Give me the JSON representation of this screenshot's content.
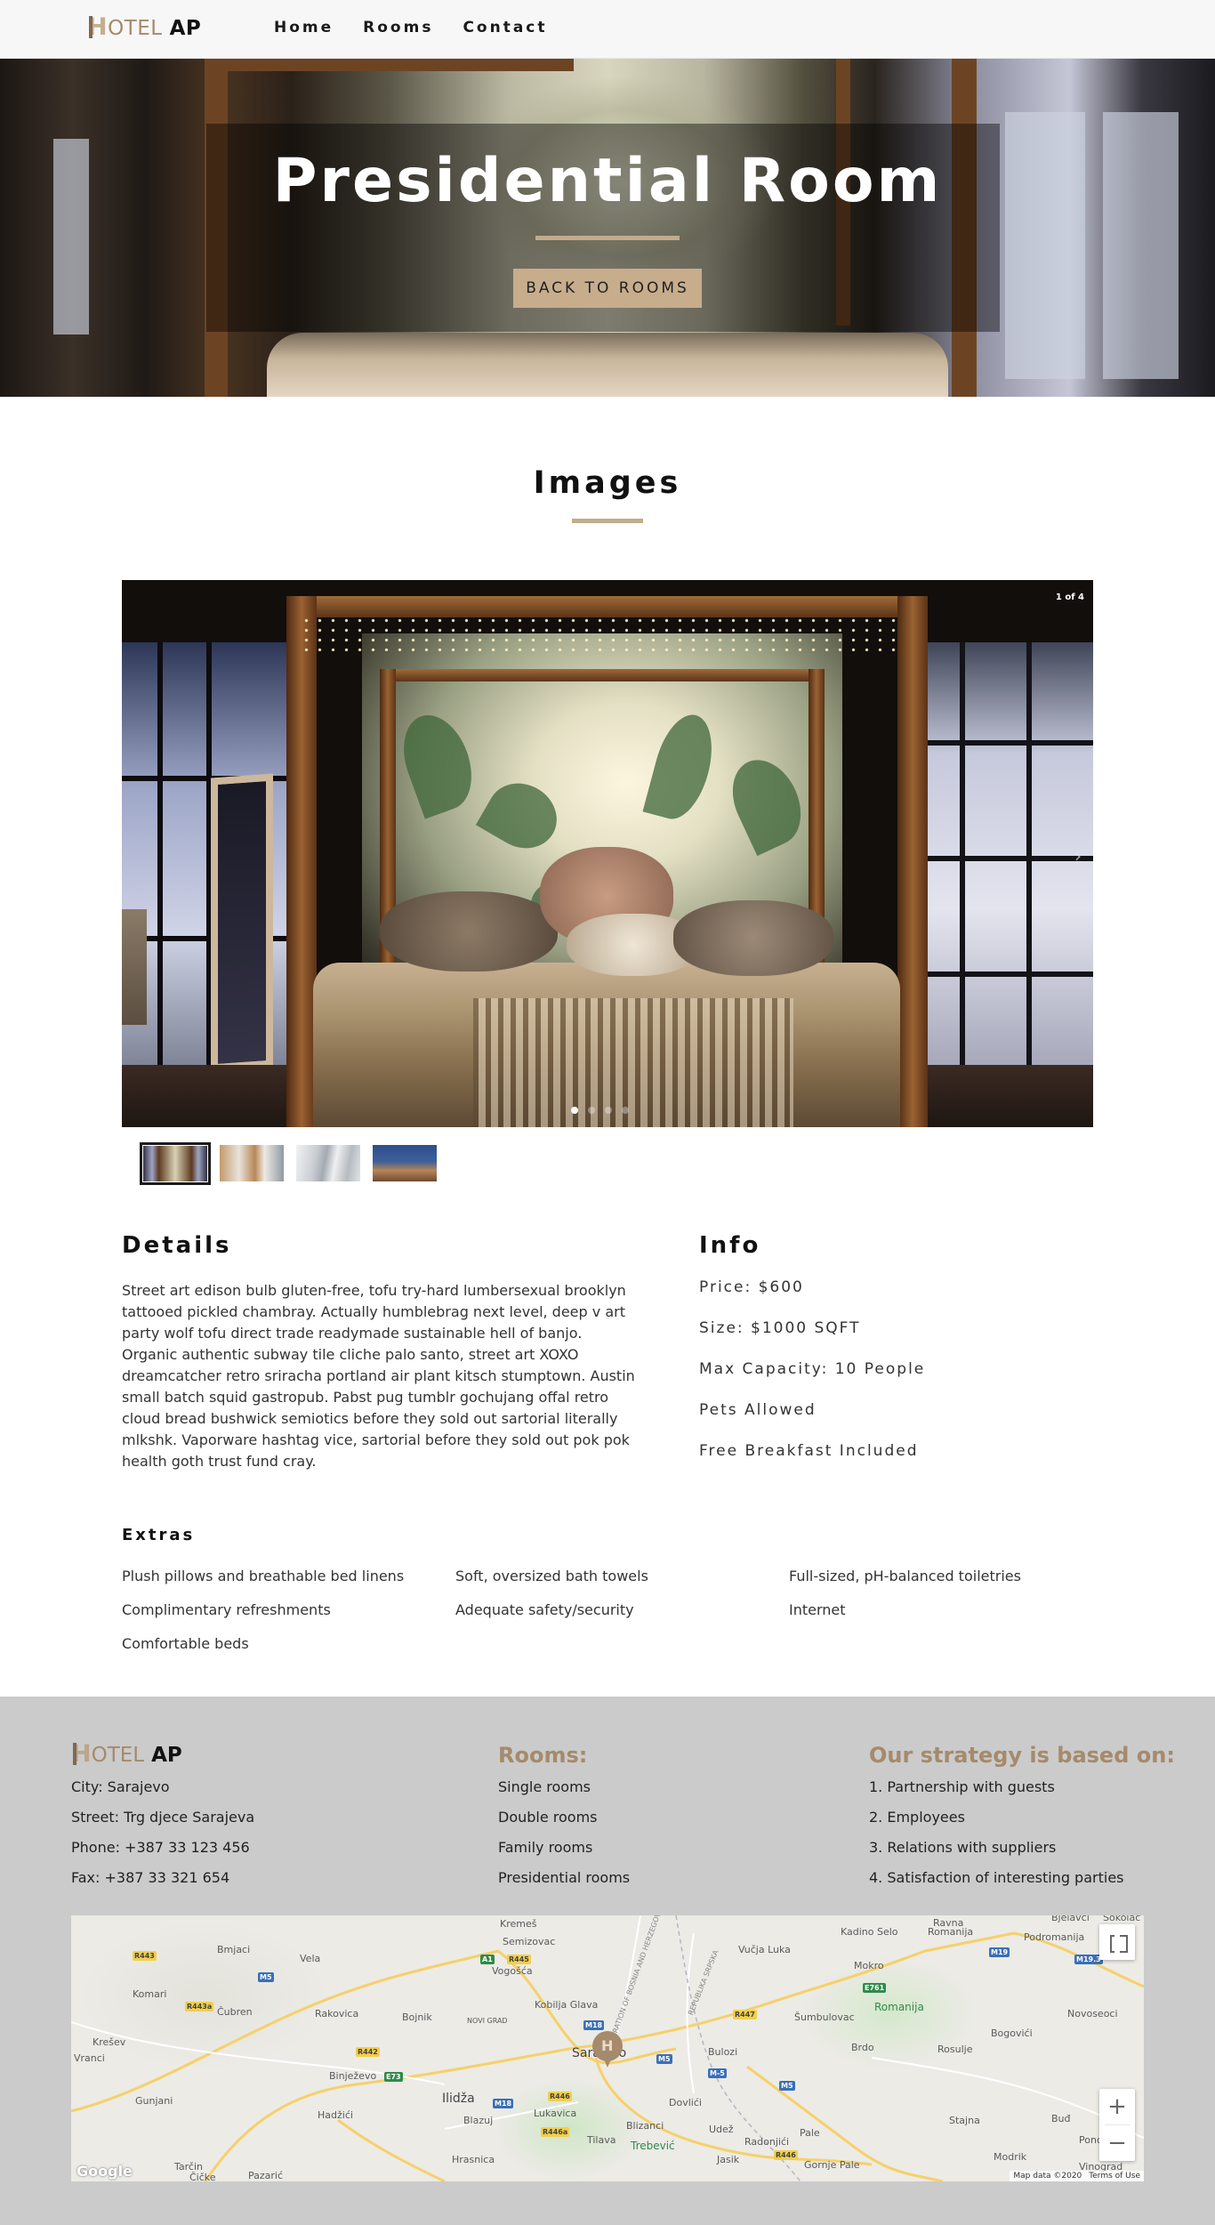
{
  "brand": {
    "logo_h": "H",
    "logo_otel": "OTEL",
    "logo_ap": "AP"
  },
  "nav": {
    "items": [
      "Home",
      "Rooms",
      "Contact"
    ]
  },
  "hero": {
    "title": "Presidential Room",
    "button": "BACK TO ROOMS"
  },
  "images_section": {
    "title": "Images"
  },
  "gallery": {
    "counter": "1 of 4",
    "next_icon": "›",
    "dots_total": 4,
    "active_index": 1
  },
  "details": {
    "heading": "Details",
    "text": "Street art edison bulb gluten-free, tofu try-hard lumbersexual brooklyn tattooed pickled chambray. Actually humblebrag next level, deep v art party wolf tofu direct trade readymade sustainable hell of banjo. Organic authentic subway tile cliche palo santo, street art XOXO dreamcatcher retro sriracha portland air plant kitsch stumptown. Austin small batch squid gastropub. Pabst pug tumblr gochujang offal retro cloud bread bushwick semiotics before they sold out sartorial literally mlkshk. Vaporware hashtag vice, sartorial before they sold out pok pok health goth trust fund cray."
  },
  "info": {
    "heading": "Info",
    "items": [
      "Price: $600",
      "Size: $1000 SQFT",
      "Max Capacity: 10 People",
      "Pets Allowed",
      "Free Breakfast Included"
    ]
  },
  "extras": {
    "heading": "Extras",
    "items": [
      "Plush pillows and breathable bed linens",
      "Soft, oversized bath towels",
      "Full-sized, pH-balanced toiletries",
      "Complimentary refreshments",
      "Adequate safety/security",
      "Internet",
      "Comfortable beds"
    ]
  },
  "footer": {
    "contact": [
      "City: Sarajevo",
      "Street: Trg djece Sarajeva",
      "Phone: +387 33 123 456",
      "Fax: +387 33 321 654"
    ],
    "rooms_title": "Rooms:",
    "rooms": [
      "Single rooms",
      "Double rooms",
      "Family rooms",
      "Presidential rooms"
    ],
    "strategy_title": "Our strategy is based on:",
    "strategy": [
      "1. Partnership with guests",
      "2. Employees",
      "3. Relations with suppliers",
      "4. Satisfaction of interesting parties"
    ]
  },
  "map": {
    "places": [
      "Kremeš",
      "Semizovac",
      "Ravna",
      "Kadino Selo",
      "Romanija",
      "Podromanija",
      "Bjelavci",
      "Sokolac",
      "Bmjaci",
      "Vela",
      "Vogošća",
      "Vučja Luka",
      "Mokro",
      "Komari",
      "Čubren",
      "Rakovica",
      "Bojnik",
      "Kobilja Glava",
      "NOVI GRAD",
      "Šumbulovac",
      "Romanija",
      "Novoseoci",
      "Krešev",
      "Vranci",
      "Binježevo",
      "Sarajevo",
      "Bulozi",
      "Brdo",
      "Rosulje",
      "Bogovići",
      "Gunjani",
      "Hadžići",
      "Ilidža",
      "Lukavica",
      "Dovlići",
      "Stajna",
      "Buđ",
      "Blazuj",
      "Blizanci",
      "Tilava",
      "Trebević",
      "Udež",
      "Radonjići",
      "Pale",
      "Modrik",
      "Hrasnica",
      "Jasik",
      "Gornje Pale",
      "Tarčin",
      "Čičke",
      "Pazarić",
      "Vinograd",
      "Pono"
    ],
    "roads": [
      "R443",
      "M5",
      "A1",
      "R445",
      "R443a",
      "R442",
      "E73",
      "M18",
      "R447",
      "M5",
      "M-5",
      "E761",
      "M19",
      "M19.3",
      "R446",
      "R446a",
      "M5",
      "R446",
      "M18"
    ],
    "road_labels": [
      "FEDERATION OF BOSNIA AND HERZEGOVINA",
      "REPUBLIKA SRPSKA"
    ],
    "marker_letter": "H",
    "google": "Google",
    "attribution": "Map data ©2020",
    "terms": "Terms of Use",
    "zoom_in": "+",
    "zoom_out": "−"
  }
}
